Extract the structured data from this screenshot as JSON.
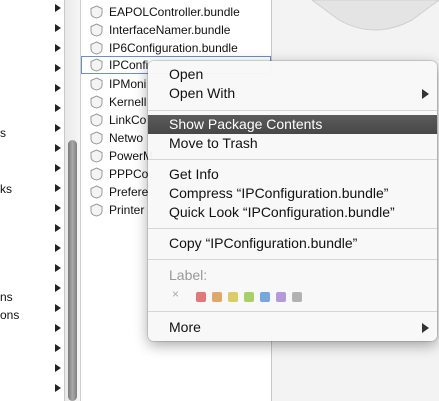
{
  "left_sidebar": {
    "fragments": [
      "s",
      "ks",
      "ns",
      "ons"
    ]
  },
  "files": [
    {
      "name": "EAPOLController.bundle"
    },
    {
      "name": "InterfaceNamer.bundle"
    },
    {
      "name": "IP6Configuration.bundle"
    },
    {
      "name": "IPConfi",
      "selected": true
    },
    {
      "name": "IPMoni"
    },
    {
      "name": "Kernell"
    },
    {
      "name": "LinkCo"
    },
    {
      "name": "Netwo"
    },
    {
      "name": "PowerM"
    },
    {
      "name": "PPPCo"
    },
    {
      "name": "Prefere"
    },
    {
      "name": "Printer"
    }
  ],
  "context_menu": {
    "open": "Open",
    "open_with": "Open With",
    "show_package_contents": "Show Package Contents",
    "move_to_trash": "Move to Trash",
    "get_info": "Get Info",
    "compress": "Compress “IPConfiguration.bundle”",
    "quick_look": "Quick Look “IPConfiguration.bundle”",
    "copy": "Copy “IPConfiguration.bundle”",
    "label_title": "Label:",
    "label_none_symbol": "×",
    "label_colors": [
      "#e07a78",
      "#e0a86a",
      "#dccb6a",
      "#a8d06a",
      "#7aa6e0",
      "#b49ad8",
      "#b2b2b2"
    ],
    "more": "More"
  },
  "colors": {
    "highlight": "#525252",
    "selection_outline": "#6b8fc8"
  }
}
